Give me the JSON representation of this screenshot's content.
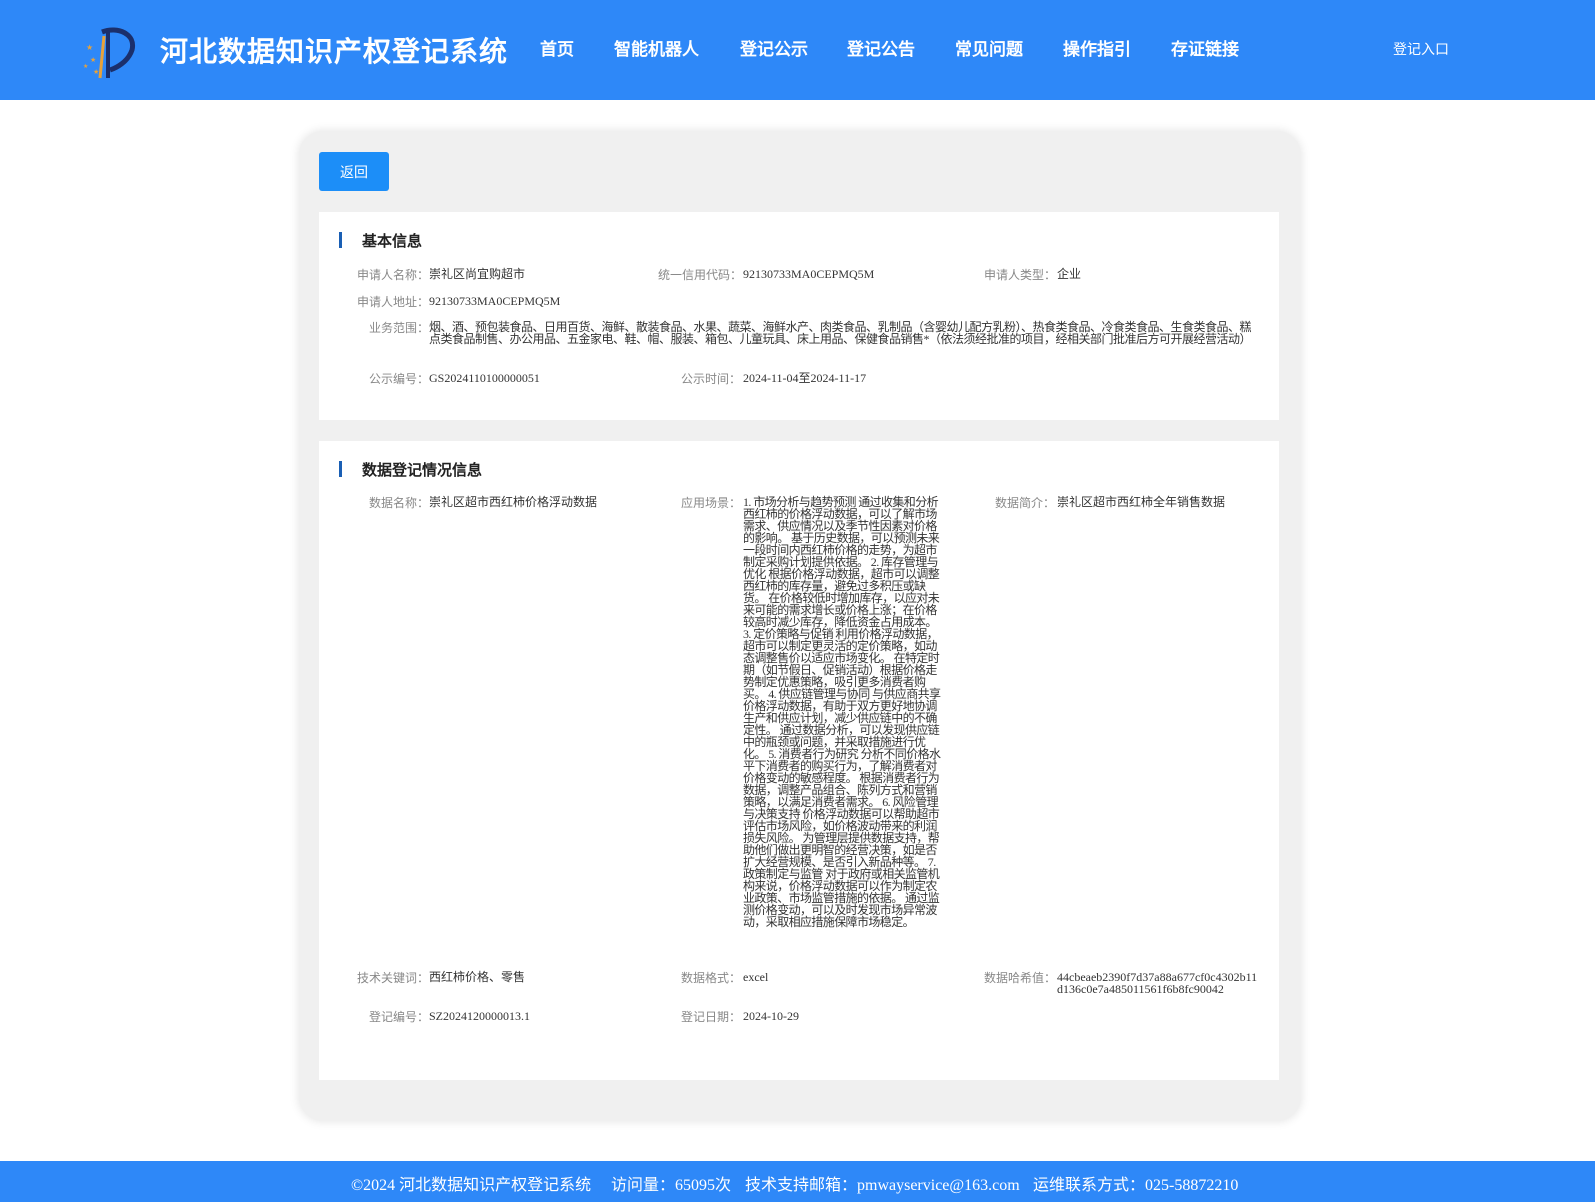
{
  "header": {
    "site_title": "河北数据知识产权登记系统",
    "nav": [
      "首页",
      "智能机器人",
      "登记公示",
      "登记公告",
      "常见问题",
      "操作指引",
      "存证链接"
    ],
    "login_label": "登记入口",
    "bg_color": "#2e88f8"
  },
  "card": {
    "back_label": "返回"
  },
  "basic": {
    "title": "基本信息",
    "applicant_name_label": "申请人名称：",
    "applicant_name": "崇礼区尚宜购超市",
    "credit_code_label": "统一信用代码：",
    "credit_code": "92130733MA0CEPMQ5M",
    "applicant_type_label": "申请人类型：",
    "applicant_type": "企业",
    "address_label": "申请人地址：",
    "address": "92130733MA0CEPMQ5M",
    "scope_label": "业务范围：",
    "scope": "烟、酒、预包装食品、日用百货、海鲜、散装食品、水果、蔬菜、海鲜水产、肉类食品、乳制品（含婴幼儿配方乳粉）、热食类食品、冷食类食品、生食类食品、糕点类食品制售、办公用品、五金家电、鞋、帽、服装、箱包、儿童玩具、床上用品、保健食品销售*（依法须经批准的项目，经相关部门批准后方可开展经营活动）",
    "notice_no_label": "公示编号：",
    "notice_no": "GS2024110100000051",
    "notice_time_label": "公示时间：",
    "notice_time": "2024-11-04至2024-11-17"
  },
  "data_reg": {
    "title": "数据登记情况信息",
    "data_name_label": "数据名称：",
    "data_name": "崇礼区超市西红柿价格浮动数据",
    "scene_label": "应用场景：",
    "scene": "1. 市场分析与趋势预测 通过收集和分析西红柿的价格浮动数据，可以了解市场需求、供应情况以及季节性因素对价格的影响。 基于历史数据，可以预测未来一段时间内西红柿价格的走势，为超市制定采购计划提供依据。 2. 库存管理与优化 根据价格浮动数据，超市可以调整西红柿的库存量，避免过多积压或缺货。 在价格较低时增加库存，以应对未来可能的需求增长或价格上涨；在价格较高时减少库存，降低资金占用成本。 3. 定价策略与促销 利用价格浮动数据，超市可以制定更灵活的定价策略，如动态调整售价以适应市场变化。 在特定时期（如节假日、促销活动）根据价格走势制定优惠策略，吸引更多消费者购买。 4. 供应链管理与协同 与供应商共享价格浮动数据，有助于双方更好地协调生产和供应计划，减少供应链中的不确定性。 通过数据分析，可以发现供应链中的瓶颈或问题，并采取措施进行优化。 5. 消费者行为研究 分析不同价格水平下消费者的购买行为，了解消费者对价格变动的敏感程度。 根据消费者行为数据，调整产品组合、陈列方式和营销策略，以满足消费者需求。 6. 风险管理与决策支持 价格浮动数据可以帮助超市评估市场风险，如价格波动带来的利润损失风险。 为管理层提供数据支持，帮助他们做出更明智的经营决策，如是否扩大经营规模、是否引入新品种等。 7. 政策制定与监管 对于政府或相关监管机构来说，价格浮动数据可以作为制定农业政策、市场监管措施的依据。 通过监测价格变动，可以及时发现市场异常波动，采取相应措施保障市场稳定。",
    "intro_label": "数据简介：",
    "intro": "崇礼区超市西红柿全年销售数据",
    "keywords_label": "技术关键词：",
    "keywords": "西红柿价格、零售",
    "format_label": "数据格式：",
    "format": "excel",
    "hash_label": "数据哈希值：",
    "hash": "44cbeaeb2390f7d37a88a677cf0c4302b11d136c0e7a485011561f6b8fc90042",
    "reg_no_label": "登记编号：",
    "reg_no": "SZ2024120000013.1",
    "reg_date_label": "登记日期：",
    "reg_date": "2024-10-29"
  },
  "footer": {
    "copyright": "©2024 河北数据知识产权登记系统",
    "visits": "访问量：65095次",
    "support": "技术支持邮箱：pmwayservice@163.com",
    "ops": "运维联系方式：025-58872210"
  }
}
